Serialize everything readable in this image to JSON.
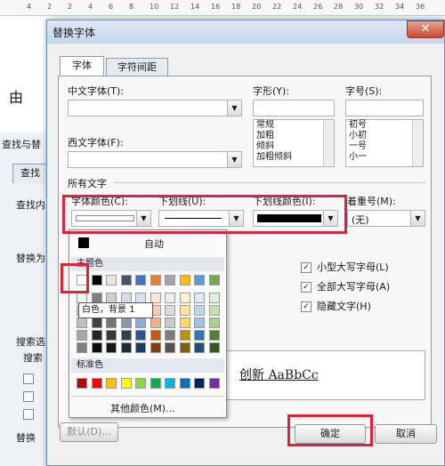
{
  "ruler": {
    "marks": [
      "4",
      "2",
      "2",
      "4",
      "6",
      "8",
      "10",
      "12",
      "14",
      "16",
      "18",
      "20",
      "22",
      "24",
      "26",
      "28",
      "30",
      "32",
      "34",
      "36"
    ]
  },
  "background": {
    "doc_char": "由",
    "find_title": "查找与替",
    "find_tab": "查找",
    "find_label": "查找内",
    "replace_label": "替换为",
    "search_label": "搜索选",
    "search_sub": "搜索",
    "replace_btn": "替换"
  },
  "dialog": {
    "title": "替换字体",
    "close": "✕",
    "tabs": [
      {
        "label": "字体"
      },
      {
        "label": "字符间距"
      }
    ],
    "cn_font_label": "中文字体(T):",
    "west_font_label": "西文字体(F):",
    "style_label": "字形(Y):",
    "style_options": [
      "常规",
      "加粗",
      "倾斜",
      "加粗倾斜"
    ],
    "size_label": "字号(S):",
    "size_options": [
      "初号",
      "小初",
      "一号",
      "小一"
    ],
    "all_text_label": "所有文字",
    "font_color_label": "字体颜色(C):",
    "underline_label": "下划线(U):",
    "underline_color_label": "下划线颜色(I):",
    "emphasis_label": "着重号(M):",
    "emphasis_value": "(无)",
    "effects": [
      {
        "label": "小型大写字母(L)",
        "checked": true
      },
      {
        "label": "全部大写字母(A)",
        "checked": true
      },
      {
        "label": "隐藏文字(H)",
        "checked": true
      }
    ],
    "preview_text": "创新 AaBbCc",
    "default_btn": "默认(D)...",
    "ok_btn": "确定",
    "cancel_btn": "取消"
  },
  "palette": {
    "auto_label": "自动",
    "theme_label": "主题色",
    "standard_label": "标准色",
    "more_label": "其他颜色(M)...",
    "tooltip": "白色，背景 1",
    "theme_top": [
      "#ffffff",
      "#000000",
      "#e7e6e6",
      "#44546a",
      "#4472c4",
      "#ed7d31",
      "#a5a5a5",
      "#ffc000",
      "#5b9bd5",
      "#70ad47"
    ],
    "theme_cols": [
      [
        "#f2f2f2",
        "#d9d9d9",
        "#bfbfbf",
        "#a6a6a6",
        "#808080"
      ],
      [
        "#7f7f7f",
        "#595959",
        "#404040",
        "#262626",
        "#0d0d0d"
      ],
      [
        "#d0cece",
        "#aeabab",
        "#757171",
        "#3a3838",
        "#171616"
      ],
      [
        "#d6dce4",
        "#adb9ca",
        "#8497b0",
        "#333f4f",
        "#222a35"
      ],
      [
        "#d9e2f3",
        "#b4c6e7",
        "#8eaadb",
        "#2f5496",
        "#1f3864"
      ],
      [
        "#fbe5d5",
        "#f7cbac",
        "#f4b183",
        "#c55a11",
        "#833c0b"
      ],
      [
        "#ededed",
        "#dbdbdb",
        "#c9c9c9",
        "#7b7b7b",
        "#525252"
      ],
      [
        "#fff2cc",
        "#ffe599",
        "#ffd966",
        "#bf9000",
        "#7f6000"
      ],
      [
        "#deebf6",
        "#bdd7ee",
        "#9cc3e5",
        "#2e75b5",
        "#1e4e79"
      ],
      [
        "#e2efd9",
        "#c5e0b3",
        "#a8d08d",
        "#538135",
        "#375623"
      ]
    ],
    "standard": [
      "#c00000",
      "#ff0000",
      "#ffc000",
      "#ffff00",
      "#92d050",
      "#00b050",
      "#00b0f0",
      "#0070c0",
      "#002060",
      "#7030a0"
    ]
  }
}
